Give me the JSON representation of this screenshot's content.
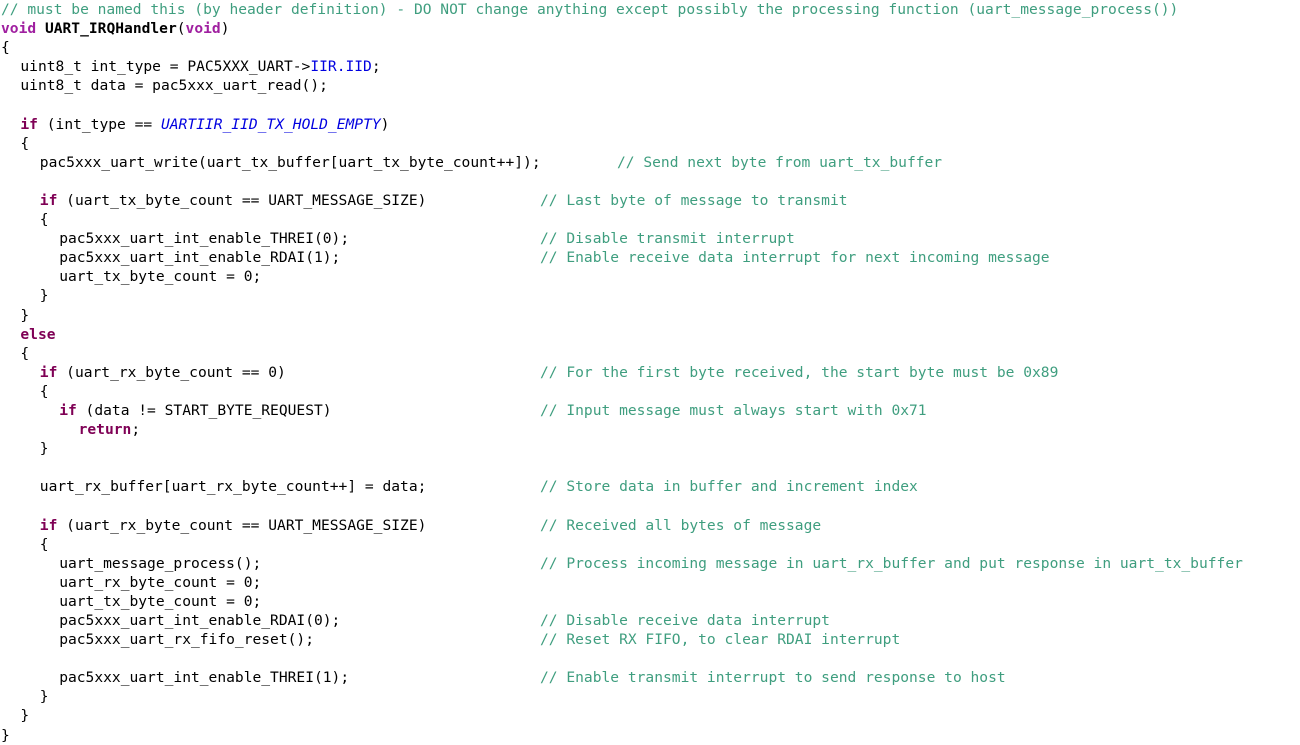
{
  "editor": {
    "background": "#ffffff",
    "font_size_px": 14.6,
    "line_height_px": 19.1,
    "colors": {
      "comment": "#3f9e7f",
      "keyword": "#7f0055",
      "type": "#a020a0",
      "function": "#000000",
      "macro": "#0000e0",
      "field": "#0000e0",
      "plain": "#000000"
    }
  },
  "code": {
    "language": "c",
    "lines": [
      {
        "indent": 0,
        "tokens": [
          {
            "kind": "comment",
            "text": "// must be named this (by header definition) - DO NOT change anything except possibly the processing function (uart_message_process())"
          }
        ]
      },
      {
        "indent": 0,
        "tokens": [
          {
            "kind": "type",
            "text": "void"
          },
          {
            "kind": "plain",
            "text": " "
          },
          {
            "kind": "function",
            "text": "UART_IRQHandler"
          },
          {
            "kind": "plain",
            "text": "("
          },
          {
            "kind": "type",
            "text": "void"
          },
          {
            "kind": "plain",
            "text": ")"
          }
        ]
      },
      {
        "indent": 0,
        "tokens": [
          {
            "kind": "plain",
            "text": "{"
          }
        ]
      },
      {
        "indent": 1,
        "tokens": [
          {
            "kind": "plain",
            "text": "uint8_t int_type = PAC5XXX_UART->"
          },
          {
            "kind": "field",
            "text": "IIR.IID"
          },
          {
            "kind": "plain",
            "text": ";"
          }
        ]
      },
      {
        "indent": 1,
        "tokens": [
          {
            "kind": "plain",
            "text": "uint8_t data = pac5xxx_uart_read();"
          }
        ]
      },
      {
        "indent": 0,
        "tokens": []
      },
      {
        "indent": 1,
        "tokens": [
          {
            "kind": "keyword",
            "text": "if"
          },
          {
            "kind": "plain",
            "text": " (int_type == "
          },
          {
            "kind": "macro",
            "text": "UARTIIR_IID_TX_HOLD_EMPTY"
          },
          {
            "kind": "plain",
            "text": ")"
          }
        ]
      },
      {
        "indent": 1,
        "tokens": [
          {
            "kind": "plain",
            "text": "{"
          }
        ]
      },
      {
        "indent": 2,
        "tokens": [
          {
            "kind": "plain",
            "text": "pac5xxx_uart_write(uart_tx_buffer[uart_tx_byte_count++]);"
          }
        ],
        "comment": "// Send next byte from uart_tx_buffer",
        "comment_col": 617
      },
      {
        "indent": 0,
        "tokens": []
      },
      {
        "indent": 2,
        "tokens": [
          {
            "kind": "keyword",
            "text": "if"
          },
          {
            "kind": "plain",
            "text": " (uart_tx_byte_count == UART_MESSAGE_SIZE)"
          }
        ],
        "comment": "// Last byte of message to transmit",
        "comment_col": 540
      },
      {
        "indent": 2,
        "tokens": [
          {
            "kind": "plain",
            "text": "{"
          }
        ]
      },
      {
        "indent": 3,
        "tokens": [
          {
            "kind": "plain",
            "text": "pac5xxx_uart_int_enable_THREI(0);"
          }
        ],
        "comment": "// Disable transmit interrupt",
        "comment_col": 540
      },
      {
        "indent": 3,
        "tokens": [
          {
            "kind": "plain",
            "text": "pac5xxx_uart_int_enable_RDAI(1);"
          }
        ],
        "comment": "// Enable receive data interrupt for next incoming message",
        "comment_col": 540
      },
      {
        "indent": 3,
        "tokens": [
          {
            "kind": "plain",
            "text": "uart_tx_byte_count = 0;"
          }
        ]
      },
      {
        "indent": 2,
        "tokens": [
          {
            "kind": "plain",
            "text": "}"
          }
        ]
      },
      {
        "indent": 1,
        "tokens": [
          {
            "kind": "plain",
            "text": "}"
          }
        ]
      },
      {
        "indent": 1,
        "tokens": [
          {
            "kind": "keyword",
            "text": "else"
          }
        ]
      },
      {
        "indent": 1,
        "tokens": [
          {
            "kind": "plain",
            "text": "{"
          }
        ]
      },
      {
        "indent": 2,
        "tokens": [
          {
            "kind": "keyword",
            "text": "if"
          },
          {
            "kind": "plain",
            "text": " (uart_rx_byte_count == 0)"
          }
        ],
        "comment": "// For the first byte received, the start byte must be 0x89",
        "comment_col": 540
      },
      {
        "indent": 2,
        "tokens": [
          {
            "kind": "plain",
            "text": "{"
          }
        ]
      },
      {
        "indent": 3,
        "tokens": [
          {
            "kind": "keyword",
            "text": "if"
          },
          {
            "kind": "plain",
            "text": " (data != START_BYTE_REQUEST)"
          }
        ],
        "comment": "// Input message must always start with 0x71",
        "comment_col": 540
      },
      {
        "indent": 4,
        "tokens": [
          {
            "kind": "keyword",
            "text": "return"
          },
          {
            "kind": "plain",
            "text": ";"
          }
        ]
      },
      {
        "indent": 2,
        "tokens": [
          {
            "kind": "plain",
            "text": "}"
          }
        ]
      },
      {
        "indent": 0,
        "tokens": []
      },
      {
        "indent": 2,
        "tokens": [
          {
            "kind": "plain",
            "text": "uart_rx_buffer[uart_rx_byte_count++] = data;"
          }
        ],
        "comment": "// Store data in buffer and increment index",
        "comment_col": 540
      },
      {
        "indent": 0,
        "tokens": []
      },
      {
        "indent": 2,
        "tokens": [
          {
            "kind": "keyword",
            "text": "if"
          },
          {
            "kind": "plain",
            "text": " (uart_rx_byte_count == UART_MESSAGE_SIZE)"
          }
        ],
        "comment": "// Received all bytes of message",
        "comment_col": 540
      },
      {
        "indent": 2,
        "tokens": [
          {
            "kind": "plain",
            "text": "{"
          }
        ]
      },
      {
        "indent": 3,
        "tokens": [
          {
            "kind": "plain",
            "text": "uart_message_process();"
          }
        ],
        "comment": "// Process incoming message in uart_rx_buffer and put response in uart_tx_buffer",
        "comment_col": 540
      },
      {
        "indent": 3,
        "tokens": [
          {
            "kind": "plain",
            "text": "uart_rx_byte_count = 0;"
          }
        ]
      },
      {
        "indent": 3,
        "tokens": [
          {
            "kind": "plain",
            "text": "uart_tx_byte_count = 0;"
          }
        ]
      },
      {
        "indent": 3,
        "tokens": [
          {
            "kind": "plain",
            "text": "pac5xxx_uart_int_enable_RDAI(0);"
          }
        ],
        "comment": "// Disable receive data interrupt",
        "comment_col": 540
      },
      {
        "indent": 3,
        "tokens": [
          {
            "kind": "plain",
            "text": "pac5xxx_uart_rx_fifo_reset();"
          }
        ],
        "comment": "// Reset RX FIFO, to clear RDAI interrupt",
        "comment_col": 540
      },
      {
        "indent": 0,
        "tokens": []
      },
      {
        "indent": 3,
        "tokens": [
          {
            "kind": "plain",
            "text": "pac5xxx_uart_int_enable_THREI(1);"
          }
        ],
        "comment": "// Enable transmit interrupt to send response to host",
        "comment_col": 540
      },
      {
        "indent": 2,
        "tokens": [
          {
            "kind": "plain",
            "text": "}"
          }
        ]
      },
      {
        "indent": 1,
        "tokens": [
          {
            "kind": "plain",
            "text": "}"
          }
        ]
      },
      {
        "indent": 0,
        "tokens": [
          {
            "kind": "plain",
            "text": "}"
          }
        ]
      }
    ]
  }
}
